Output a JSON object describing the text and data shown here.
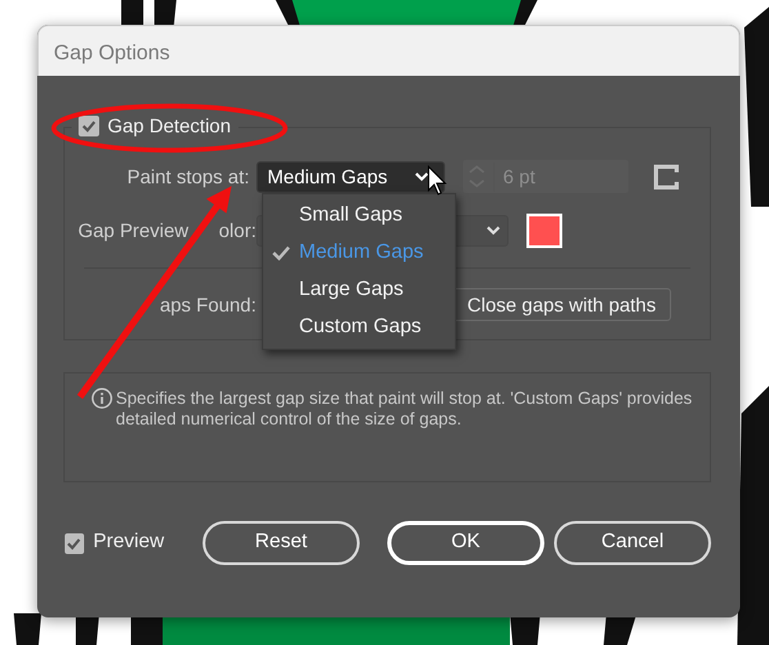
{
  "window": {
    "title": "Gap Options"
  },
  "gap_detection": {
    "label": "Gap Detection",
    "checked": true
  },
  "paint_stops": {
    "label": "Paint stops at:",
    "value": "Medium Gaps",
    "size_value": "6 pt",
    "size_disabled": true
  },
  "preview_color": {
    "label": "Gap Preview",
    "label_rest": "olor:",
    "color": "#ff5050"
  },
  "gaps_found": {
    "label": "aps Found:",
    "button": "Close gaps with paths"
  },
  "info": "Specifies the largest gap size that paint will stop at. 'Custom Gaps' provides detailed numerical control of the size of gaps.",
  "menu": {
    "items": [
      {
        "label": "Small Gaps",
        "selected": false
      },
      {
        "label": "Medium Gaps",
        "selected": true
      },
      {
        "label": "Large Gaps",
        "selected": false
      },
      {
        "label": "Custom Gaps",
        "selected": false
      }
    ]
  },
  "preview": {
    "label": "Preview",
    "checked": true
  },
  "buttons": [
    {
      "label": "Reset",
      "default": false
    },
    {
      "label": "OK",
      "default": true
    },
    {
      "label": "Cancel",
      "default": false
    }
  ]
}
